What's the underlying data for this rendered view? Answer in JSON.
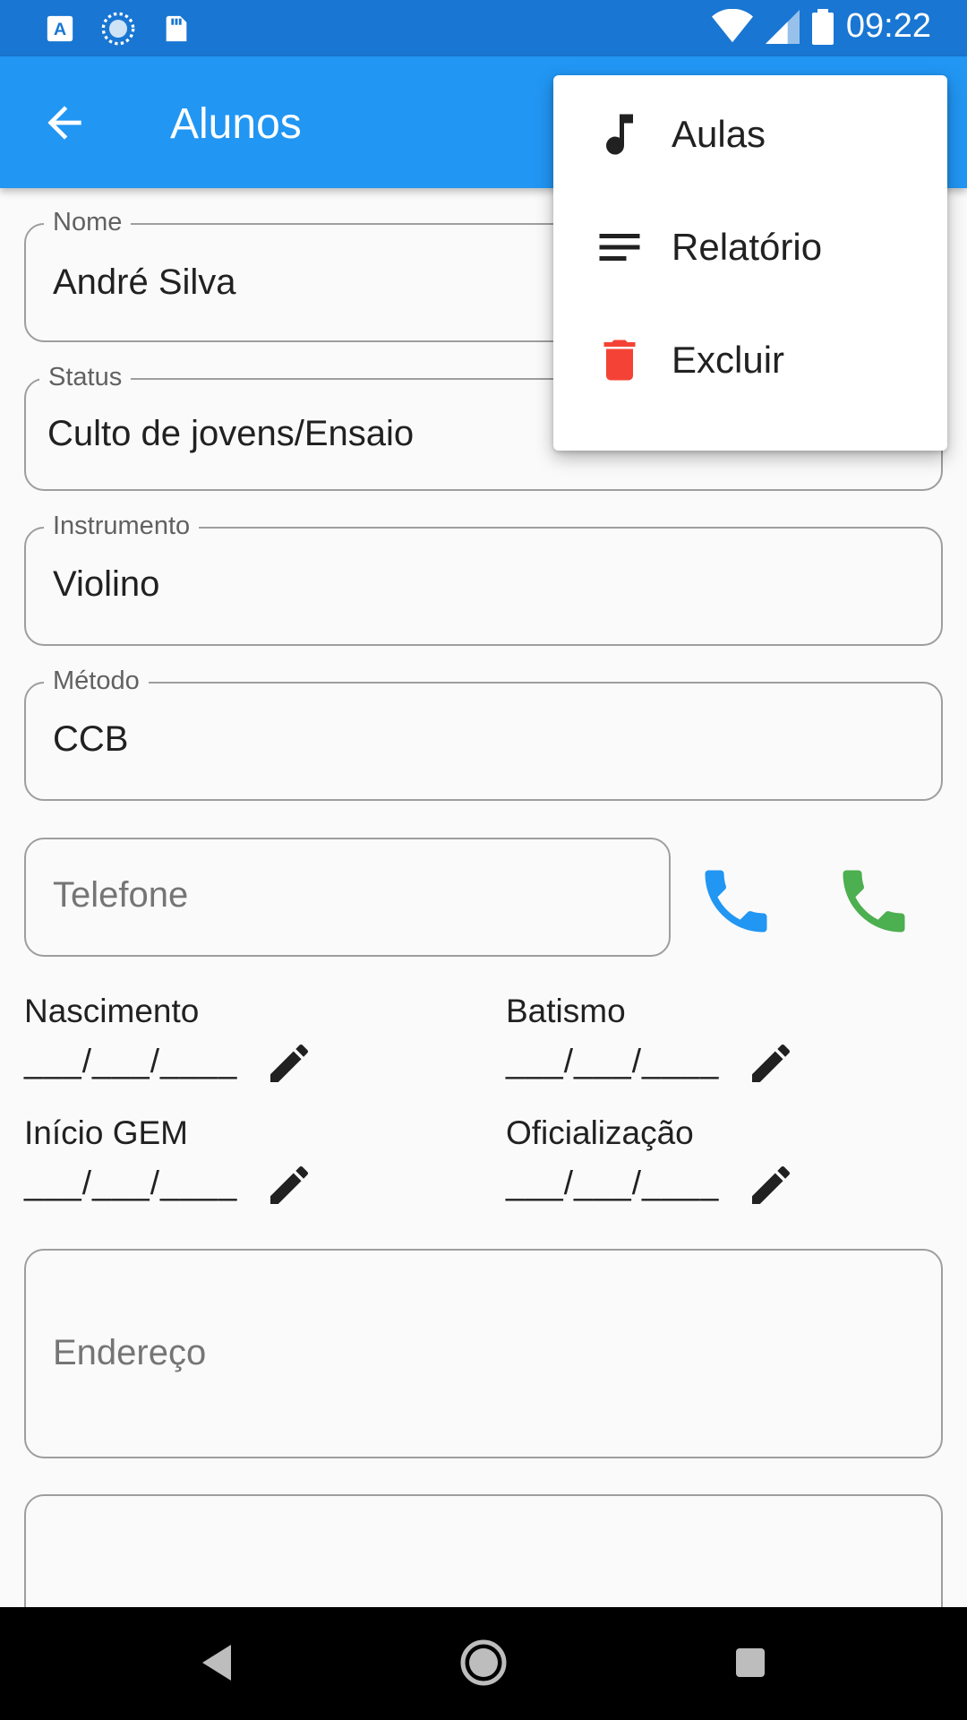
{
  "status_bar": {
    "time": "09:22",
    "icons_left": [
      "a-keyboard-icon",
      "loading-icon",
      "sd-card-icon"
    ],
    "icons_right": [
      "wifi-icon",
      "signal-icon",
      "battery-icon"
    ]
  },
  "app_bar": {
    "title": "Alunos",
    "back_icon": "arrow-back-icon",
    "color": "#2196f3"
  },
  "form": {
    "nome": {
      "label": "Nome",
      "value": "André Silva"
    },
    "status": {
      "label": "Status",
      "value": "Culto de jovens/Ensaio"
    },
    "instrumento": {
      "label": "Instrumento",
      "value": "Violino"
    },
    "metodo": {
      "label": "Método",
      "value": "CCB"
    },
    "telefone": {
      "placeholder": "Telefone"
    },
    "phone_call_color": "#2196f3",
    "whatsapp_call_color": "#4caf50",
    "dates": {
      "nascimento": {
        "label": "Nascimento",
        "value": "___/___/____"
      },
      "batismo": {
        "label": "Batismo",
        "value": "___/___/____"
      },
      "inicio_gem": {
        "label": "Início GEM",
        "value": "___/___/____"
      },
      "oficializacao": {
        "label": "Oficialização",
        "value": "___/___/____"
      }
    },
    "endereco": {
      "placeholder": "Endereço"
    }
  },
  "menu": {
    "items": [
      {
        "label": "Aulas",
        "icon": "music-note-icon"
      },
      {
        "label": "Relatório",
        "icon": "notes-icon"
      },
      {
        "label": "Excluir",
        "icon": "trash-icon",
        "icon_color": "#f44336"
      }
    ]
  },
  "nav_bar": {
    "icons": [
      "back-triangle-icon",
      "home-circle-icon",
      "recents-square-icon"
    ]
  }
}
